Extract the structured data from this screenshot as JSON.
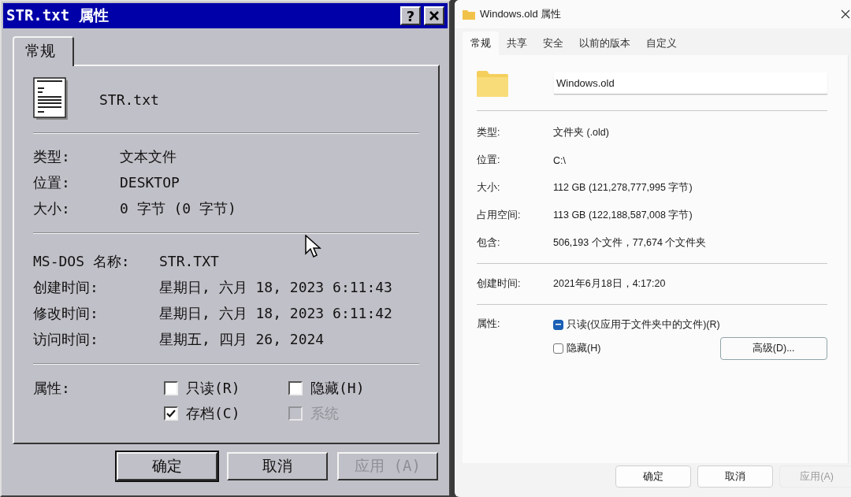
{
  "dialogs": [
    {
      "kind": "classic",
      "title": "STR.txt 属性",
      "help_button": "?",
      "tabs": [
        {
          "label": "常规",
          "selected": true
        }
      ],
      "name": "STR.txt",
      "sections": [
        [
          {
            "label": "类型:",
            "value": "文本文件"
          },
          {
            "label": "位置:",
            "value": "DESKTOP"
          },
          {
            "label": "大小:",
            "value": "0 字节 (0 字节)"
          }
        ],
        [
          {
            "label": "MS-DOS 名称:",
            "value": "STR.TXT"
          },
          {
            "label": "创建时间:",
            "value": "星期日, 六月 18, 2023 6:11:43"
          },
          {
            "label": "修改时间:",
            "value": "星期日, 六月 18, 2023 6:11:42"
          },
          {
            "label": "访问时间:",
            "value": "星期五, 四月 26, 2024"
          }
        ]
      ],
      "attributes": {
        "label": "属性:",
        "options": [
          {
            "label": "只读(R)",
            "checked": false,
            "disabled": false
          },
          {
            "label": "隐藏(H)",
            "checked": false,
            "disabled": false
          },
          {
            "label": "存档(C)",
            "checked": true,
            "disabled": false
          },
          {
            "label": "系统",
            "checked": false,
            "disabled": true
          }
        ]
      },
      "buttons": [
        {
          "label": "确定",
          "disabled": false,
          "default": true
        },
        {
          "label": "取消",
          "disabled": false,
          "default": false
        },
        {
          "label": "应用 (A)",
          "disabled": true,
          "default": false
        }
      ]
    },
    {
      "kind": "modern",
      "title": "Windows.old 属性",
      "tabs": [
        {
          "label": "常规",
          "selected": true
        },
        {
          "label": "共享",
          "selected": false
        },
        {
          "label": "安全",
          "selected": false
        },
        {
          "label": "以前的版本",
          "selected": false
        },
        {
          "label": "自定义",
          "selected": false
        }
      ],
      "name": "Windows.old",
      "sections": [
        [
          {
            "label": "类型:",
            "value": "文件夹 (.old)"
          },
          {
            "label": "位置:",
            "value": "C:\\"
          },
          {
            "label": "大小:",
            "value": "112 GB (121,278,777,995 字节)"
          },
          {
            "label": "占用空间:",
            "value": "113 GB (122,188,587,008 字节)"
          },
          {
            "label": "包含:",
            "value": "506,193 个文件，77,674 个文件夹"
          }
        ],
        [
          {
            "label": "创建时间:",
            "value": "2021年6月18日，4:17:20"
          }
        ]
      ],
      "attributes": {
        "label": "属性:",
        "options": [
          {
            "label": "只读(仅应用于文件夹中的文件)(R)",
            "checked": false,
            "mixed": true
          },
          {
            "label": "隐藏(H)",
            "checked": false,
            "mixed": false
          }
        ],
        "advanced_button": "高级(D)..."
      },
      "buttons": [
        {
          "label": "确定",
          "disabled": false,
          "default": false
        },
        {
          "label": "取消",
          "disabled": false,
          "default": false
        },
        {
          "label": "应用(A)",
          "disabled": true,
          "default": false
        }
      ]
    }
  ]
}
